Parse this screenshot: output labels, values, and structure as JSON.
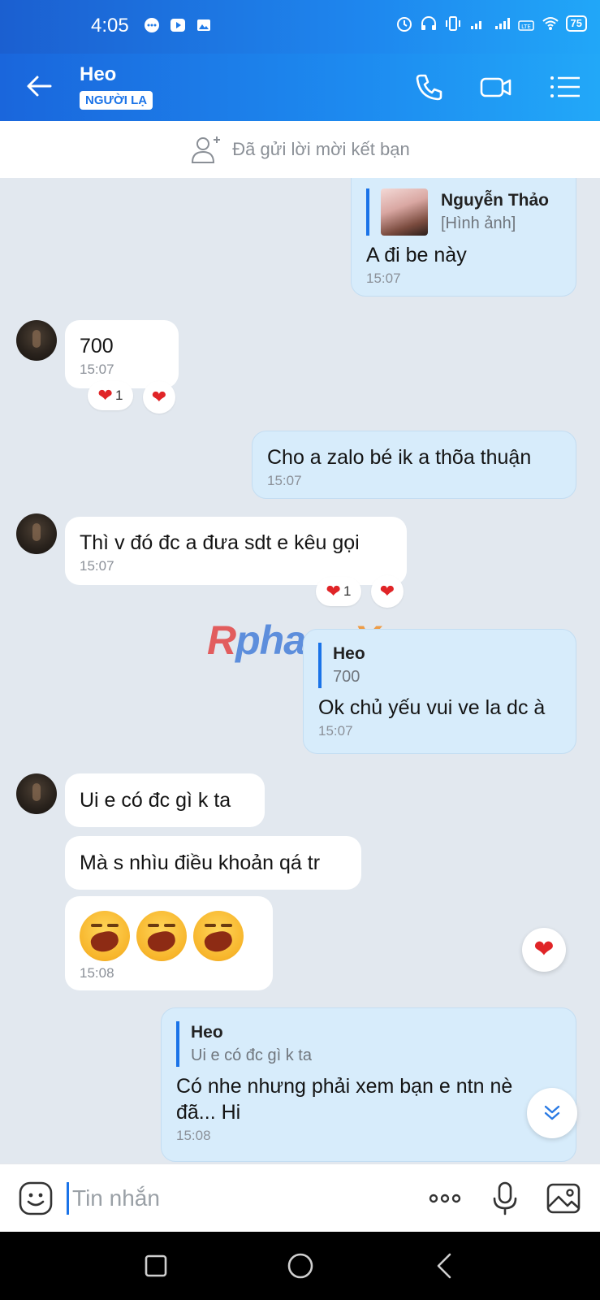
{
  "status_bar": {
    "time": "4:05",
    "battery": "75"
  },
  "header": {
    "contact_name": "Heo",
    "badge": "NGƯỜI LẠ"
  },
  "friend_request": {
    "text": "Đã gửi lời mời kết bạn"
  },
  "messages": [
    {
      "quote_name": "Nguyễn Thảo",
      "quote_text": "[Hình ảnh]",
      "text": "A đi be này",
      "time": "15:07"
    },
    {
      "text": "700",
      "time": "15:07",
      "reaction_count": "1"
    },
    {
      "text": "Cho a zalo bé ik a thõa thuận",
      "time": "15:07"
    },
    {
      "text": "Thì v đó đc a đưa sdt e kêu gọi",
      "time": "15:07",
      "reaction_count": "1"
    },
    {
      "quote_name": "Heo",
      "quote_text": "700",
      "text": "Ok chủ yếu vui ve la dc à",
      "time": "15:07"
    },
    {
      "text": "Ui e có đc gì k ta"
    },
    {
      "text": "Mà s nhìu điều khoản qá tr"
    },
    {
      "emoji_count": 3,
      "time": "15:08"
    },
    {
      "quote_name": "Heo",
      "quote_text": "Ui e có đc gì k ta",
      "text": "Có nhe nhưng phải xem bạn e ntn nè đã... Hi",
      "time": "15:08"
    }
  ],
  "watermark": {
    "part1": "Rphang",
    "part2": "X"
  },
  "input": {
    "placeholder": "Tin nhắn"
  },
  "colors": {
    "accent": "#1a73e8",
    "outgoing_bubble": "#d7ecfb",
    "heart": "#e02427"
  }
}
